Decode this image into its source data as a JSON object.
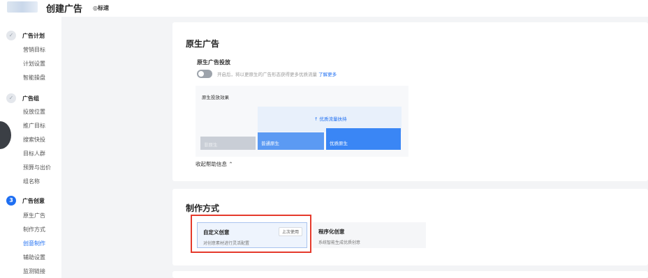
{
  "header": {
    "title": "创建广告",
    "mode_badge": "◎标速"
  },
  "sidebar": {
    "steps": [
      {
        "icon": "✓",
        "title": "广告计划",
        "items": [
          "营销目标",
          "计划设置",
          "智能操盘"
        ]
      },
      {
        "icon": "✓",
        "title": "广告组",
        "items": [
          "投放位置",
          "推广目标",
          "搜索快投",
          "目标人群",
          "预算与出价",
          "组名称"
        ]
      },
      {
        "icon": "3",
        "title": "广告创意",
        "items": [
          "原生广告",
          "制作方式",
          "创意制作",
          "辅助设置",
          "监测链接"
        ]
      }
    ],
    "active_item": "创意制作"
  },
  "native_ad": {
    "title": "原生广告",
    "subtitle": "原生广告投放",
    "toggle_desc": "开启后，将以更原生的广告形态获得更多优质流量",
    "learn_more": "了解更多",
    "effect_title": "原生投放效果",
    "boost_label": "↑ 优质流量扶持",
    "bars": [
      "非原生",
      "普通原生",
      "优质原生"
    ],
    "collapse_label": "收起帮助信息 ⌃"
  },
  "production": {
    "title": "制作方式",
    "options": [
      {
        "title": "自定义创意",
        "desc": "对创意素材进行灵活配置",
        "badge": "上次使用"
      },
      {
        "title": "程序化创意",
        "desc": "系统智能生成优质创意"
      }
    ]
  },
  "colors": {
    "accent": "#1f6ff2",
    "highlight": "#e5392b"
  }
}
